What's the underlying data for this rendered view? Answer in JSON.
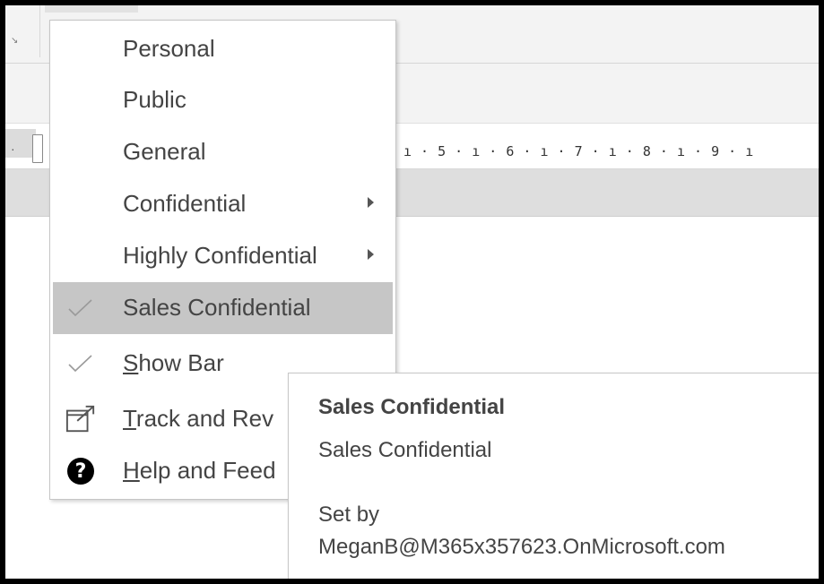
{
  "ruler": {
    "ticks": "ı · 5 · ı · 6 · ı · 7 · ı · 8 · ı · 9 · ı"
  },
  "menu": {
    "items": [
      {
        "label": "Personal",
        "has_submenu": false,
        "checked": false,
        "selected": false
      },
      {
        "label": "Public",
        "has_submenu": false,
        "checked": false,
        "selected": false
      },
      {
        "label": "General",
        "has_submenu": false,
        "checked": false,
        "selected": false
      },
      {
        "label": "Confidential",
        "has_submenu": true,
        "checked": false,
        "selected": false
      },
      {
        "label": "Highly Confidential",
        "has_submenu": true,
        "checked": false,
        "selected": false
      },
      {
        "label": "Sales Confidential",
        "has_submenu": false,
        "checked": true,
        "selected": true
      },
      {
        "label_prefix": "S",
        "label_rest": "how Bar",
        "checked": true,
        "icon": "checkmark-icon"
      },
      {
        "label_prefix": "T",
        "label_rest": "rack and Rev",
        "icon": "external-window-icon"
      },
      {
        "label_prefix": "H",
        "label_rest": "elp and Feed",
        "icon": "help-icon"
      }
    ]
  },
  "tooltip": {
    "title": "Sales Confidential",
    "description": "Sales Confidential",
    "set_by_label": "Set by",
    "set_by_user": "MeganB@M365x357623.OnMicrosoft.com"
  },
  "colors": {
    "selected_background": "#c6c6c6",
    "menu_text": "#444444",
    "frame": "#000000"
  }
}
